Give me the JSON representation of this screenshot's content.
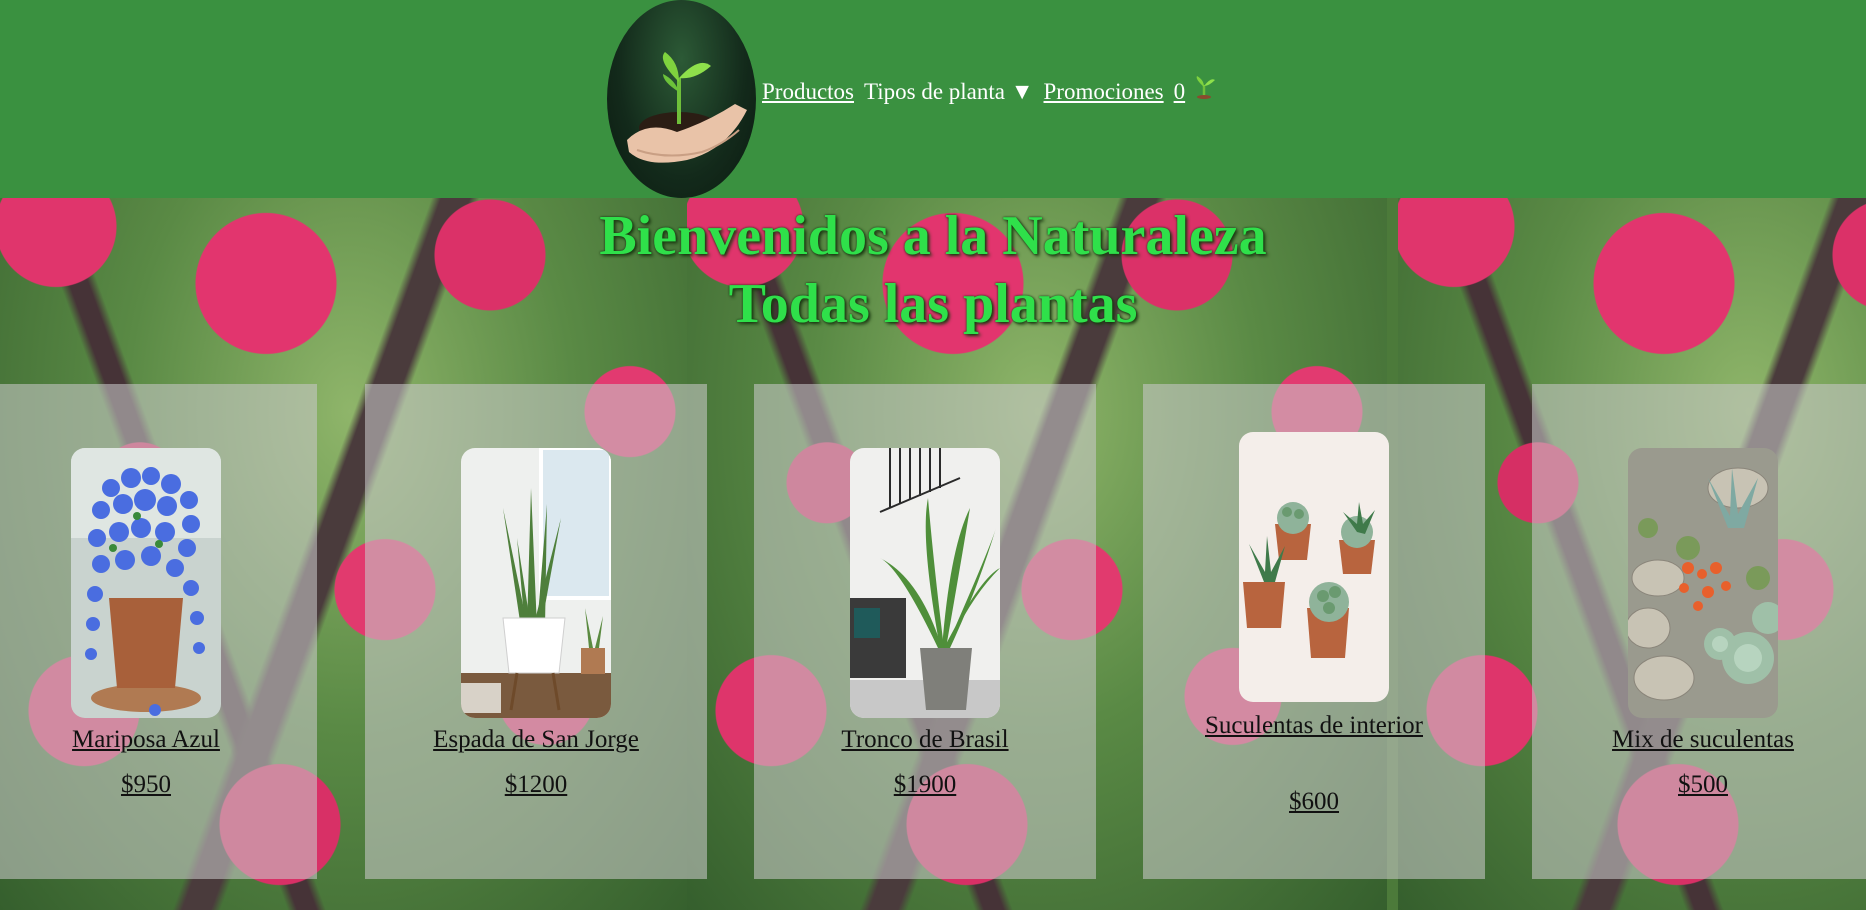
{
  "header": {
    "nav": {
      "productos": "Productos",
      "tipos": "Tipos de planta ▼",
      "promociones": "Promociones",
      "cart_count": "0"
    }
  },
  "hero": {
    "title": "Bienvenidos a la Naturaleza",
    "subtitle": "Todas las plantas"
  },
  "products": [
    {
      "name": "Mariposa Azul",
      "price": "$950"
    },
    {
      "name": "Espada de San Jorge",
      "price": "$1200"
    },
    {
      "name": "Tronco de Brasil",
      "price": "$1900"
    },
    {
      "name": "Suculentas de interior",
      "price": "$600"
    },
    {
      "name": "Mix de suculentas",
      "price": "$500"
    }
  ],
  "colors": {
    "header_bg": "#3a9140",
    "title_green": "#2fe04a",
    "card_overlay": "rgba(200,200,200,0.58)"
  }
}
